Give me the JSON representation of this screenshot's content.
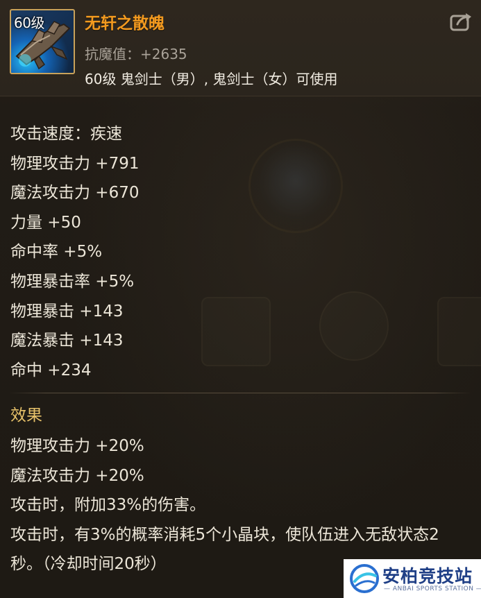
{
  "item": {
    "level_tag": "60级",
    "name": "无轩之散魄",
    "resist_label": "抗魔值：+2635",
    "usable_by": "60级 鬼剑士（男）, 鬼剑士（女）可使用",
    "icon": "weapon-icon"
  },
  "header": {
    "share_icon": "share-icon"
  },
  "stats": [
    "攻击速度：疾速",
    "物理攻击力 +791",
    "魔法攻击力 +670",
    "力量 +50",
    "命中率 +5%",
    "物理暴击率 +5%",
    "物理暴击 +143",
    "魔法暴击 +143",
    "命中 +234"
  ],
  "effects": {
    "title": "效果",
    "lines": [
      "物理攻击力 +20%",
      "魔法攻击力 +20%",
      "攻击时，附加33%的伤害。",
      "攻击时，有3%的概率消耗5个小晶块，使队伍进入无敌状态2秒。（冷却时间20秒）"
    ]
  },
  "watermark": {
    "title": "安柏竞技站",
    "subtitle": "— ANBAI SPORTS STATION —"
  },
  "colors": {
    "item_name": "#f39a1f",
    "effects_title": "#e7c26a",
    "icon_border": "#c9a25a",
    "background": "#1e1a14"
  }
}
